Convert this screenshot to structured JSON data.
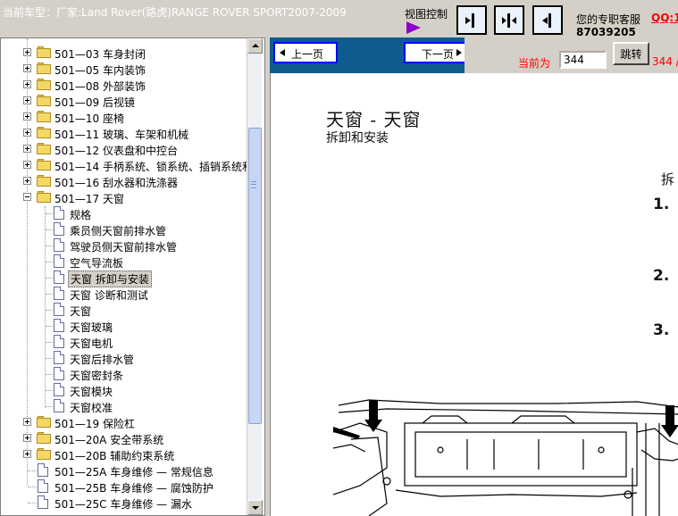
{
  "topbar": {
    "car_title": "当前车型：厂家:Land Rover(路虎)RANGE ROVER SPORT2007-2009",
    "view_control": "视图控制",
    "service_label": "您的专职客服",
    "qq_label": "QQ:1",
    "phone": "87039205"
  },
  "tree": {
    "items": [
      {
        "label": "501—03 车身封闭"
      },
      {
        "label": "501—05 车内装饰"
      },
      {
        "label": "501—08 外部装饰"
      },
      {
        "label": "501—09 后视镜"
      },
      {
        "label": "501—10 座椅"
      },
      {
        "label": "501—11 玻璃、车架和机械"
      },
      {
        "label": "501—12 仪表盘和中控台"
      },
      {
        "label": "501—14 手柄系统、锁系统、插销系统和"
      },
      {
        "label": "501—16 刮水器和洗涤器"
      },
      {
        "label": "501—17 天窗"
      },
      {
        "label": "规格"
      },
      {
        "label": "乘员侧天窗前排水管"
      },
      {
        "label": "驾驶员侧天窗前排水管"
      },
      {
        "label": "空气导流板"
      },
      {
        "label": "天窗 拆卸与安装"
      },
      {
        "label": "天窗 诊断和测试"
      },
      {
        "label": "天窗"
      },
      {
        "label": "天窗玻璃"
      },
      {
        "label": "天窗电机"
      },
      {
        "label": "天窗后排水管"
      },
      {
        "label": "天窗密封条"
      },
      {
        "label": "天窗模块"
      },
      {
        "label": "天窗校准"
      },
      {
        "label": "501—19 保险杠"
      },
      {
        "label": "501—20A 安全带系统"
      },
      {
        "label": "501—20B 辅助约束系统"
      },
      {
        "label": "501—25A 车身维修 — 常规信息"
      },
      {
        "label": "501—25B 车身维修 — 腐蚀防护"
      },
      {
        "label": "501—25C 车身维修 — 漏水"
      }
    ]
  },
  "nav": {
    "prev_label": "上一页",
    "next_label": "下一页",
    "current_label": "当前为",
    "page_value": "344",
    "jump_label": "跳转",
    "page_total": "344 /"
  },
  "document": {
    "title": "天窗 - 天窗",
    "subtitle": "拆卸和安装",
    "side_text": "拆",
    "steps": [
      "1.",
      "2.",
      "3."
    ]
  },
  "colors": {
    "nav_bar": "#0e5c8f",
    "accent_red": "#ff0000",
    "view_arrow": "#8a00c8"
  }
}
